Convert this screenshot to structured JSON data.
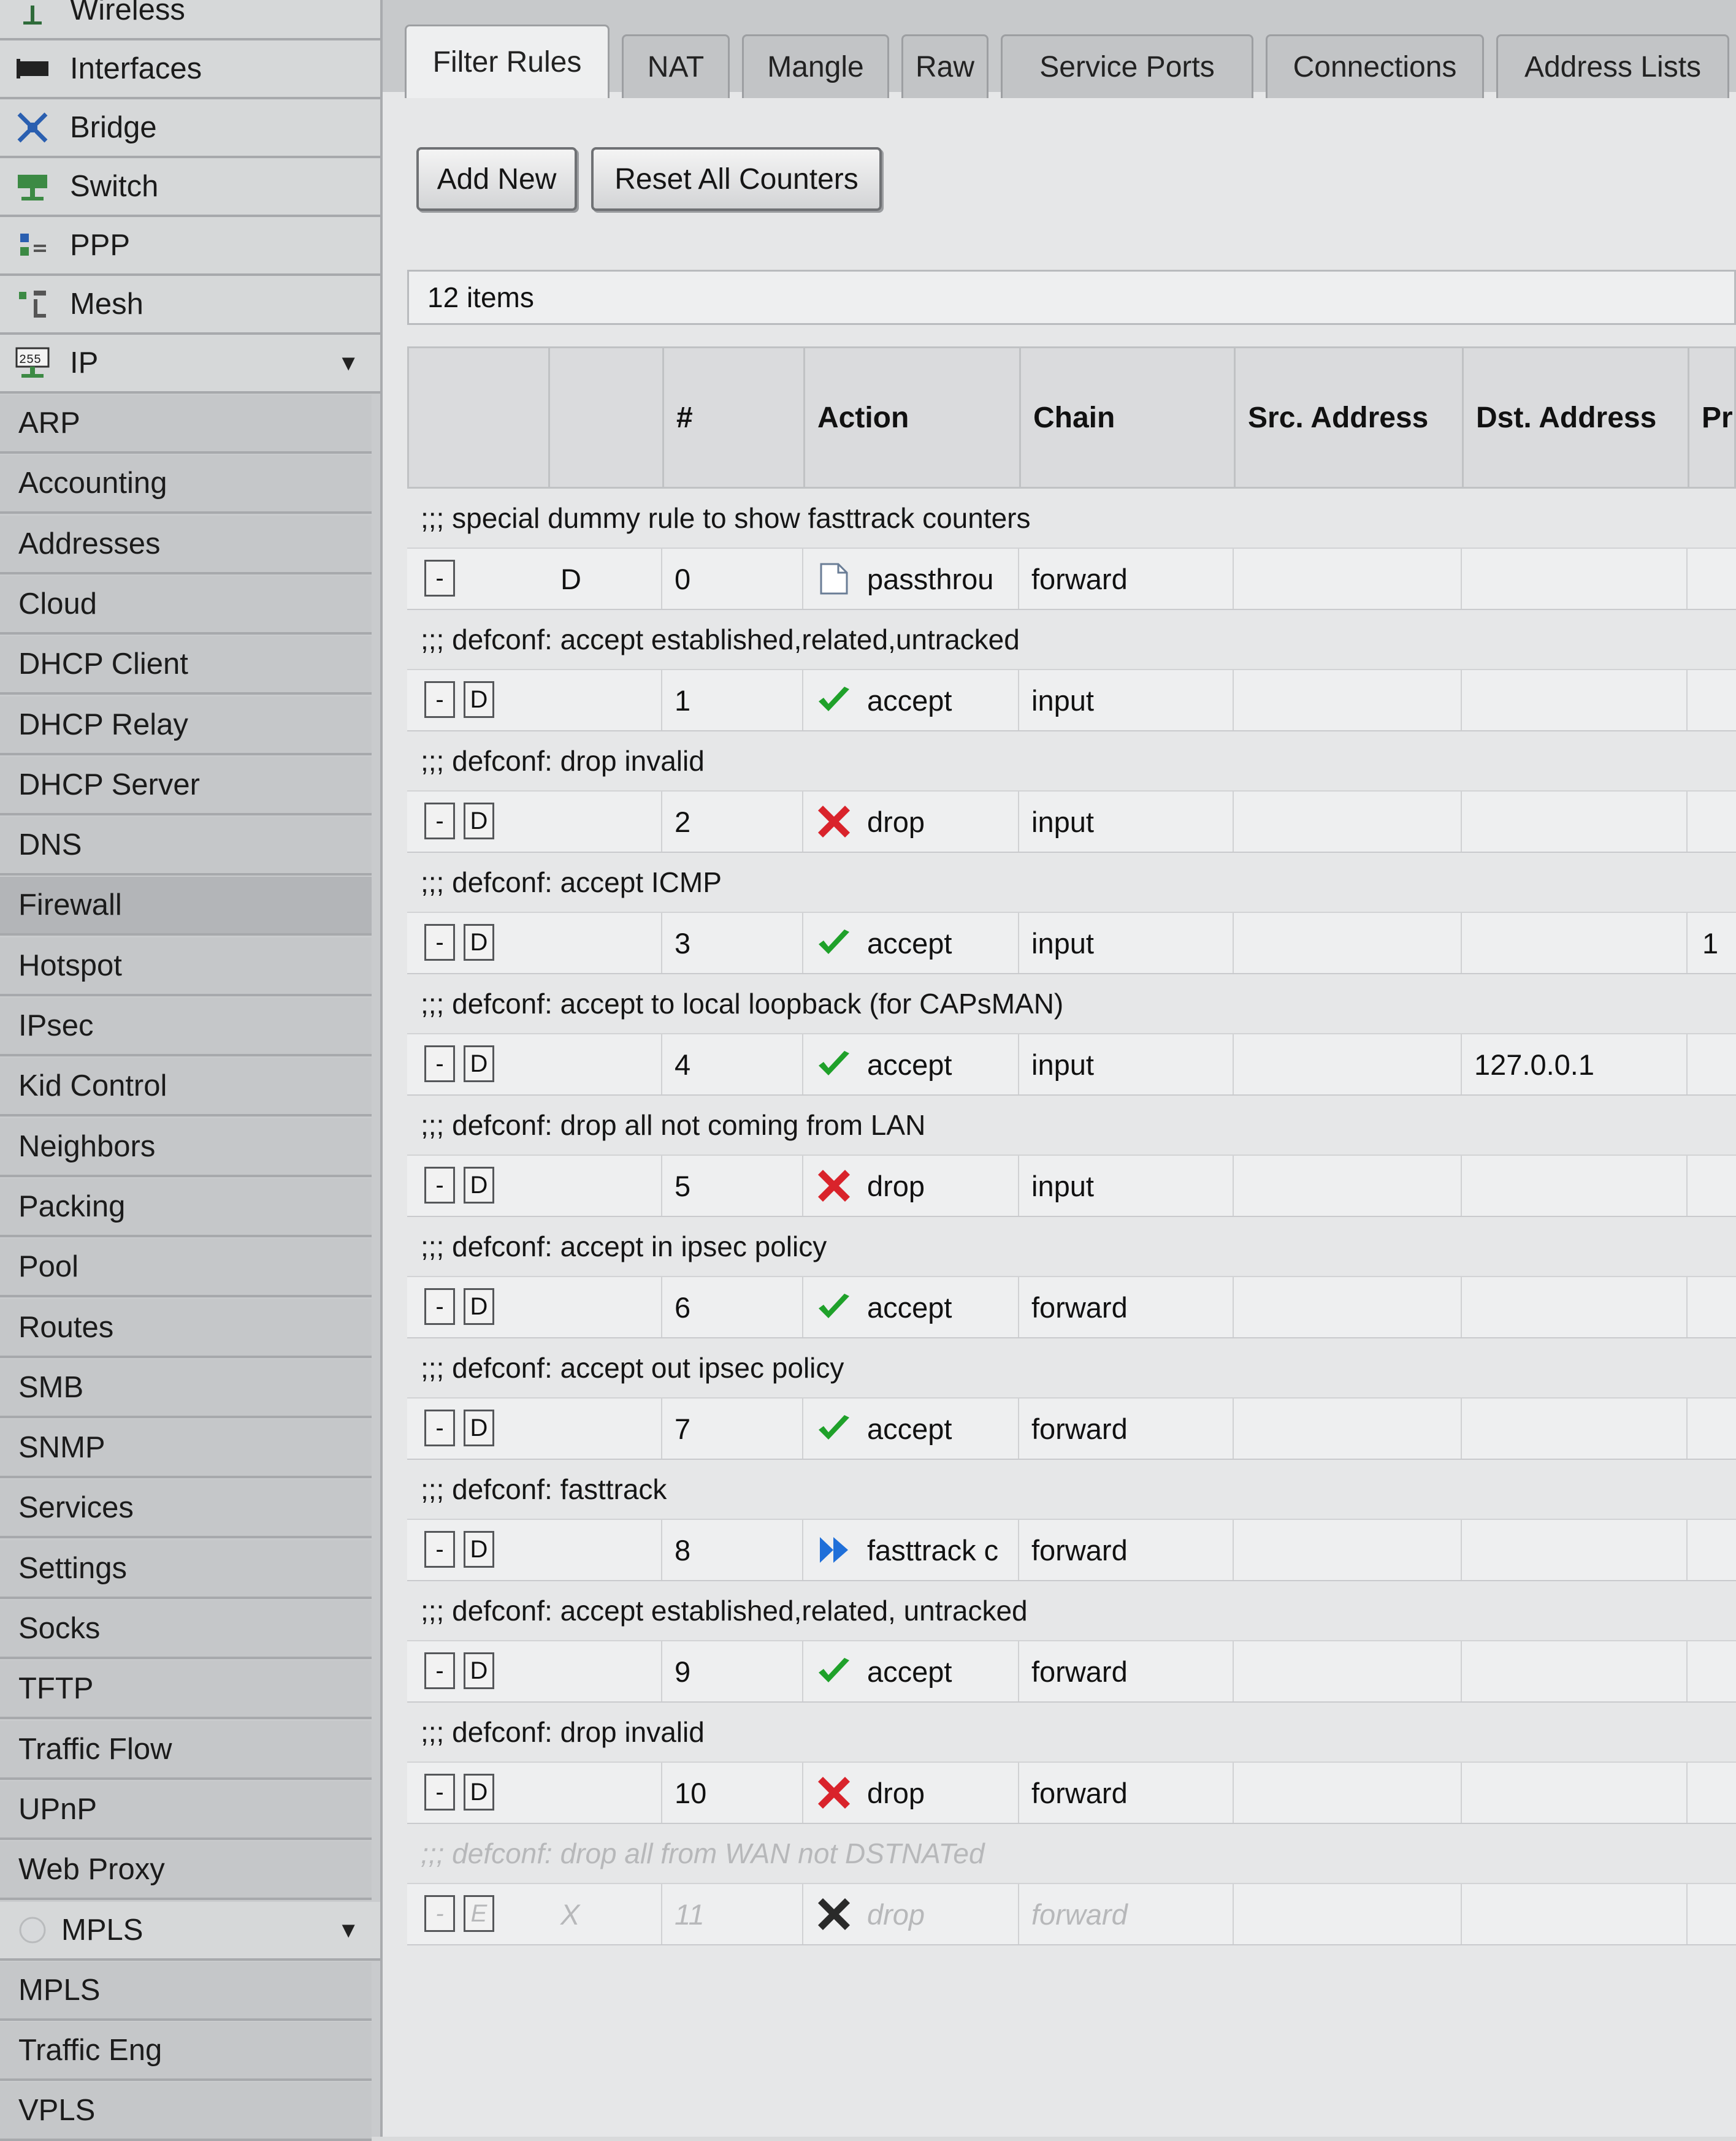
{
  "sidebar": {
    "top_items": [
      {
        "label": "Wireless",
        "icon": "wireless-icon"
      },
      {
        "label": "Interfaces",
        "icon": "interfaces-icon"
      },
      {
        "label": "Bridge",
        "icon": "bridge-icon"
      },
      {
        "label": "Switch",
        "icon": "switch-icon"
      },
      {
        "label": "PPP",
        "icon": "ppp-icon"
      },
      {
        "label": "Mesh",
        "icon": "mesh-icon"
      },
      {
        "label": "IP",
        "icon": "ip-icon",
        "expanded": true
      }
    ],
    "ip_items": [
      "ARP",
      "Accounting",
      "Addresses",
      "Cloud",
      "DHCP Client",
      "DHCP Relay",
      "DHCP Server",
      "DNS",
      "Firewall",
      "Hotspot",
      "IPsec",
      "Kid Control",
      "Neighbors",
      "Packing",
      "Pool",
      "Routes",
      "SMB",
      "SNMP",
      "Services",
      "Settings",
      "Socks",
      "TFTP",
      "Traffic Flow",
      "UPnP",
      "Web Proxy"
    ],
    "active_item": "Firewall",
    "mpls_label": "MPLS",
    "mpls_items": [
      "MPLS",
      "Traffic Eng",
      "VPLS"
    ]
  },
  "tabs": [
    "Filter Rules",
    "NAT",
    "Mangle",
    "Raw",
    "Service Ports",
    "Connections",
    "Address Lists"
  ],
  "active_tab": "Filter Rules",
  "buttons": {
    "add_new": "Add New",
    "reset_counters": "Reset All Counters"
  },
  "items_count": "12 items",
  "columns": [
    "",
    "",
    "#",
    "Action",
    "Chain",
    "Src. Address",
    "Dst. Address",
    "Pr"
  ],
  "rules": [
    {
      "comment": ";;; special dummy rule to show fasttrack counters",
      "btn1": "-",
      "btn2": "",
      "flag": "D",
      "num": "0",
      "action_icon": "passthrough-icon",
      "action": "passthrou",
      "chain": "forward",
      "src": "",
      "dst": "",
      "proto": "",
      "disabled": false
    },
    {
      "comment": ";;; defconf: accept established,related,untracked",
      "btn1": "-",
      "btn2": "D",
      "flag": "",
      "num": "1",
      "action_icon": "accept-icon",
      "action": "accept",
      "chain": "input",
      "src": "",
      "dst": "",
      "proto": "",
      "disabled": false
    },
    {
      "comment": ";;; defconf: drop invalid",
      "btn1": "-",
      "btn2": "D",
      "flag": "",
      "num": "2",
      "action_icon": "drop-icon",
      "action": "drop",
      "chain": "input",
      "src": "",
      "dst": "",
      "proto": "",
      "disabled": false
    },
    {
      "comment": ";;; defconf: accept ICMP",
      "btn1": "-",
      "btn2": "D",
      "flag": "",
      "num": "3",
      "action_icon": "accept-icon",
      "action": "accept",
      "chain": "input",
      "src": "",
      "dst": "",
      "proto": "1",
      "disabled": false
    },
    {
      "comment": ";;; defconf: accept to local loopback (for CAPsMAN)",
      "btn1": "-",
      "btn2": "D",
      "flag": "",
      "num": "4",
      "action_icon": "accept-icon",
      "action": "accept",
      "chain": "input",
      "src": "",
      "dst": "127.0.0.1",
      "proto": "",
      "disabled": false
    },
    {
      "comment": ";;; defconf: drop all not coming from LAN",
      "btn1": "-",
      "btn2": "D",
      "flag": "",
      "num": "5",
      "action_icon": "drop-icon",
      "action": "drop",
      "chain": "input",
      "src": "",
      "dst": "",
      "proto": "",
      "disabled": false
    },
    {
      "comment": ";;; defconf: accept in ipsec policy",
      "btn1": "-",
      "btn2": "D",
      "flag": "",
      "num": "6",
      "action_icon": "accept-icon",
      "action": "accept",
      "chain": "forward",
      "src": "",
      "dst": "",
      "proto": "",
      "disabled": false
    },
    {
      "comment": ";;; defconf: accept out ipsec policy",
      "btn1": "-",
      "btn2": "D",
      "flag": "",
      "num": "7",
      "action_icon": "accept-icon",
      "action": "accept",
      "chain": "forward",
      "src": "",
      "dst": "",
      "proto": "",
      "disabled": false
    },
    {
      "comment": ";;; defconf: fasttrack",
      "btn1": "-",
      "btn2": "D",
      "flag": "",
      "num": "8",
      "action_icon": "fasttrack-icon",
      "action": "fasttrack c",
      "chain": "forward",
      "src": "",
      "dst": "",
      "proto": "",
      "disabled": false
    },
    {
      "comment": ";;; defconf: accept established,related, untracked",
      "btn1": "-",
      "btn2": "D",
      "flag": "",
      "num": "9",
      "action_icon": "accept-icon",
      "action": "accept",
      "chain": "forward",
      "src": "",
      "dst": "",
      "proto": "",
      "disabled": false
    },
    {
      "comment": ";;; defconf: drop invalid",
      "btn1": "-",
      "btn2": "D",
      "flag": "",
      "num": "10",
      "action_icon": "drop-icon",
      "action": "drop",
      "chain": "forward",
      "src": "",
      "dst": "",
      "proto": "",
      "disabled": false
    },
    {
      "comment": ";;; defconf: drop all from WAN not DSTNATed",
      "btn1": "-",
      "btn2": "E",
      "flag": "X",
      "num": "11",
      "action_icon": "drop-icon",
      "action": "drop",
      "chain": "forward",
      "src": "",
      "dst": "",
      "proto": "",
      "disabled": true
    }
  ],
  "colors": {
    "accept": "#1fa12a",
    "drop": "#d9232b",
    "fasttrack": "#1f6fd9"
  }
}
